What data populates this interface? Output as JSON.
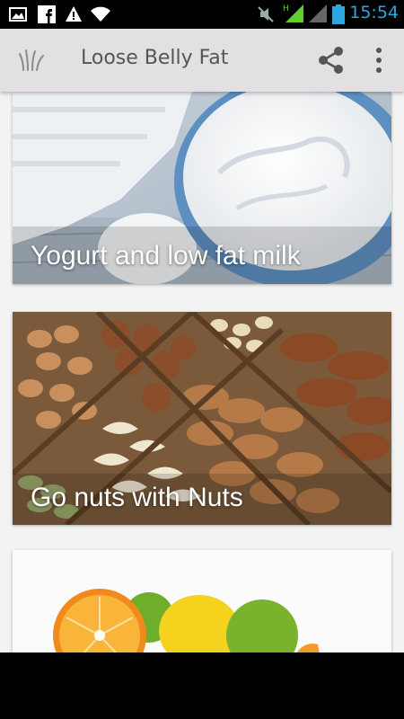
{
  "status_bar": {
    "time": "15:54",
    "icons": [
      "gallery-icon",
      "facebook-icon",
      "warning-icon",
      "wifi-icon",
      "mute-icon",
      "signal-h-icon",
      "signal-icon",
      "battery-icon"
    ]
  },
  "toolbar": {
    "title": "Loose Belly Fat",
    "app_icon": "app-logo-icon",
    "share_icon": "share-icon",
    "overflow_icon": "overflow-menu-icon"
  },
  "cards": [
    {
      "title": "Yogurt and low fat milk",
      "image": "yogurt-bowl"
    },
    {
      "title": "Go nuts with Nuts",
      "image": "mixed-nuts-tray"
    },
    {
      "title": "",
      "image": "citrus-fruits"
    }
  ],
  "colors": {
    "status_time": "#2aa7dc",
    "toolbar_bg": "#e3e0e3",
    "signal_green": "#5fcf2b",
    "content_bg": "#f3f3f3"
  }
}
